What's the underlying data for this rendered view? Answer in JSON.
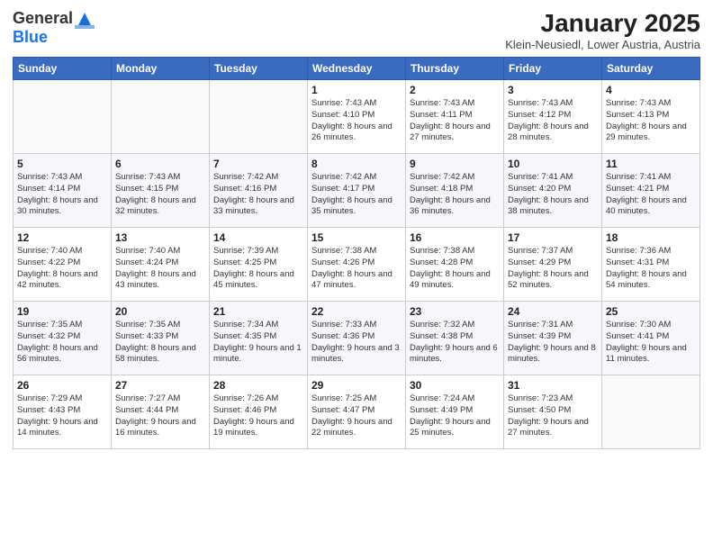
{
  "logo": {
    "general": "General",
    "blue": "Blue"
  },
  "header": {
    "month": "January 2025",
    "location": "Klein-Neusiedl, Lower Austria, Austria"
  },
  "weekdays": [
    "Sunday",
    "Monday",
    "Tuesday",
    "Wednesday",
    "Thursday",
    "Friday",
    "Saturday"
  ],
  "weeks": [
    [
      {
        "day": "",
        "content": ""
      },
      {
        "day": "",
        "content": ""
      },
      {
        "day": "",
        "content": ""
      },
      {
        "day": "1",
        "content": "Sunrise: 7:43 AM\nSunset: 4:10 PM\nDaylight: 8 hours and 26 minutes."
      },
      {
        "day": "2",
        "content": "Sunrise: 7:43 AM\nSunset: 4:11 PM\nDaylight: 8 hours and 27 minutes."
      },
      {
        "day": "3",
        "content": "Sunrise: 7:43 AM\nSunset: 4:12 PM\nDaylight: 8 hours and 28 minutes."
      },
      {
        "day": "4",
        "content": "Sunrise: 7:43 AM\nSunset: 4:13 PM\nDaylight: 8 hours and 29 minutes."
      }
    ],
    [
      {
        "day": "5",
        "content": "Sunrise: 7:43 AM\nSunset: 4:14 PM\nDaylight: 8 hours and 30 minutes."
      },
      {
        "day": "6",
        "content": "Sunrise: 7:43 AM\nSunset: 4:15 PM\nDaylight: 8 hours and 32 minutes."
      },
      {
        "day": "7",
        "content": "Sunrise: 7:42 AM\nSunset: 4:16 PM\nDaylight: 8 hours and 33 minutes."
      },
      {
        "day": "8",
        "content": "Sunrise: 7:42 AM\nSunset: 4:17 PM\nDaylight: 8 hours and 35 minutes."
      },
      {
        "day": "9",
        "content": "Sunrise: 7:42 AM\nSunset: 4:18 PM\nDaylight: 8 hours and 36 minutes."
      },
      {
        "day": "10",
        "content": "Sunrise: 7:41 AM\nSunset: 4:20 PM\nDaylight: 8 hours and 38 minutes."
      },
      {
        "day": "11",
        "content": "Sunrise: 7:41 AM\nSunset: 4:21 PM\nDaylight: 8 hours and 40 minutes."
      }
    ],
    [
      {
        "day": "12",
        "content": "Sunrise: 7:40 AM\nSunset: 4:22 PM\nDaylight: 8 hours and 42 minutes."
      },
      {
        "day": "13",
        "content": "Sunrise: 7:40 AM\nSunset: 4:24 PM\nDaylight: 8 hours and 43 minutes."
      },
      {
        "day": "14",
        "content": "Sunrise: 7:39 AM\nSunset: 4:25 PM\nDaylight: 8 hours and 45 minutes."
      },
      {
        "day": "15",
        "content": "Sunrise: 7:38 AM\nSunset: 4:26 PM\nDaylight: 8 hours and 47 minutes."
      },
      {
        "day": "16",
        "content": "Sunrise: 7:38 AM\nSunset: 4:28 PM\nDaylight: 8 hours and 49 minutes."
      },
      {
        "day": "17",
        "content": "Sunrise: 7:37 AM\nSunset: 4:29 PM\nDaylight: 8 hours and 52 minutes."
      },
      {
        "day": "18",
        "content": "Sunrise: 7:36 AM\nSunset: 4:31 PM\nDaylight: 8 hours and 54 minutes."
      }
    ],
    [
      {
        "day": "19",
        "content": "Sunrise: 7:35 AM\nSunset: 4:32 PM\nDaylight: 8 hours and 56 minutes."
      },
      {
        "day": "20",
        "content": "Sunrise: 7:35 AM\nSunset: 4:33 PM\nDaylight: 8 hours and 58 minutes."
      },
      {
        "day": "21",
        "content": "Sunrise: 7:34 AM\nSunset: 4:35 PM\nDaylight: 9 hours and 1 minute."
      },
      {
        "day": "22",
        "content": "Sunrise: 7:33 AM\nSunset: 4:36 PM\nDaylight: 9 hours and 3 minutes."
      },
      {
        "day": "23",
        "content": "Sunrise: 7:32 AM\nSunset: 4:38 PM\nDaylight: 9 hours and 6 minutes."
      },
      {
        "day": "24",
        "content": "Sunrise: 7:31 AM\nSunset: 4:39 PM\nDaylight: 9 hours and 8 minutes."
      },
      {
        "day": "25",
        "content": "Sunrise: 7:30 AM\nSunset: 4:41 PM\nDaylight: 9 hours and 11 minutes."
      }
    ],
    [
      {
        "day": "26",
        "content": "Sunrise: 7:29 AM\nSunset: 4:43 PM\nDaylight: 9 hours and 14 minutes."
      },
      {
        "day": "27",
        "content": "Sunrise: 7:27 AM\nSunset: 4:44 PM\nDaylight: 9 hours and 16 minutes."
      },
      {
        "day": "28",
        "content": "Sunrise: 7:26 AM\nSunset: 4:46 PM\nDaylight: 9 hours and 19 minutes."
      },
      {
        "day": "29",
        "content": "Sunrise: 7:25 AM\nSunset: 4:47 PM\nDaylight: 9 hours and 22 minutes."
      },
      {
        "day": "30",
        "content": "Sunrise: 7:24 AM\nSunset: 4:49 PM\nDaylight: 9 hours and 25 minutes."
      },
      {
        "day": "31",
        "content": "Sunrise: 7:23 AM\nSunset: 4:50 PM\nDaylight: 9 hours and 27 minutes."
      },
      {
        "day": "",
        "content": ""
      }
    ]
  ]
}
